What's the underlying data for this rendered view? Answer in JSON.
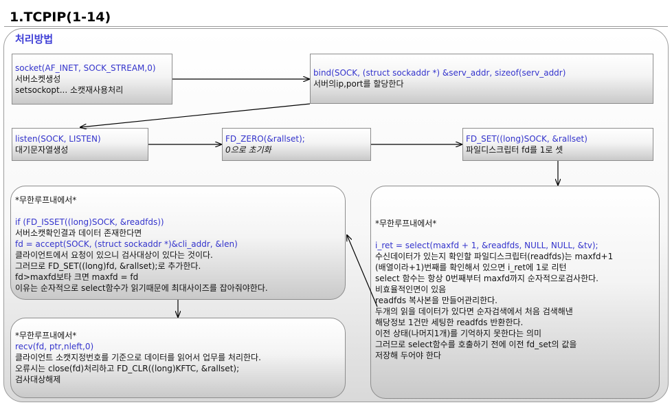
{
  "header": {
    "title": "1.TCPIP(1-14)"
  },
  "panel": {
    "title": "처리방법"
  },
  "boxes": {
    "socket": {
      "lines": [
        "socket(AF_INET, SOCK_STREAM,0)",
        "서버소켓생성",
        "setsockopt... 소캣재사용처리"
      ]
    },
    "bind": {
      "lines": [
        "bind(SOCK, (struct sockaddr *) &serv_addr, sizeof(serv_addr)",
        "서버의ip,port를 할당한다"
      ]
    },
    "listen": {
      "lines": [
        "listen(SOCK, LISTEN)",
        "대기문자열생성"
      ]
    },
    "fdzero": {
      "lines": [
        "FD_ZERO(&rallset);",
        "0으로 초기화"
      ]
    },
    "fdset": {
      "lines": [
        "FD_SET((long)SOCK, &rallset)",
        " 파일디스크립터 fd를 1로 셋"
      ]
    },
    "loop1": {
      "lines": [
        "*무한루프내에서*",
        "",
        "if (FD_ISSET((long)SOCK, &readfds))",
        "서버소캣확인결과 데이터 존재한다면",
        "fd = accept(SOCK, (struct sockaddr *)&cli_addr, &len)",
        "클라이언트에서 요청이 있으니 검사대상이 있다는 것이다.",
        "그러므로 FD_SET((long)fd, &rallset);로 추가한다.",
        "fd>maxfd보타 크면 maxfd = fd",
        "이유는 순자적으로 select함수가 읽기때문에 최대사이즈를 잡아줘야한다."
      ]
    },
    "loop2": {
      "lines": [
        "*무한루프내에서*",
        "recv(fd, ptr,nleft,0)",
        "클라이언트 소캣지정번호를 기준으로 데이터를 읽어서 업무를 처리한다.",
        "오류시는 close(fd)처리하고 FD_CLR((long)KFTC, &rallset);",
        "검사대상해제"
      ]
    },
    "loop3": {
      "lines": [
        "*무한루프내에서*",
        "",
        "i_ret = select(maxfd + 1, &readfds, NULL, NULL, &tv);",
        "수신데이터가 있는지 확인할 파일디스크립터(readfds)는 maxfd+1",
        "(배열이라+1)번째를 확인해서 있으면 i_ret에 1로 리턴",
        "select 함수는 항상 0번째부터 maxfd까지 순자적으로검사한다.",
        "비효율적인면이 있음",
        "readfds 복사본을 만들어관리한다.",
        "두개의 읽을 데이터가 있다면 순자검색에서 처음 검색해낸",
        "해당정보 1건만 세팅한 readfds 반환한다.",
        "이전 상태(나머지1개)를 기억하지 못한다는 의미",
        "그러므로 select함수를 호출하기 전에 이전 fd_set의 값을",
        "저장해 두어야 한다"
      ]
    }
  },
  "colors": {
    "code_text": "#3333cc",
    "heading_text": "#3d3dd6",
    "arrow": "#000000"
  }
}
